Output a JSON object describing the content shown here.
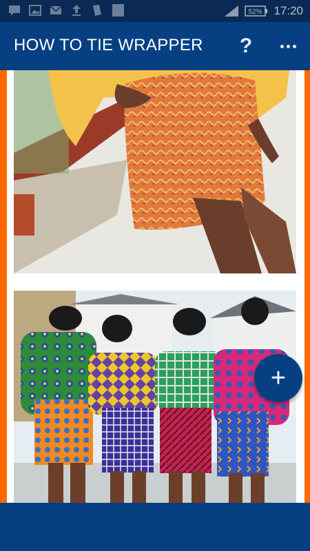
{
  "status_bar": {
    "battery": "52%",
    "time": "17:20",
    "icons": [
      "message-icon",
      "image-icon",
      "mail-icon",
      "upload-icon",
      "file-icon",
      "square-icon",
      "signal-icon",
      "battery-icon"
    ]
  },
  "app_bar": {
    "title": "HOW TO TIE WRAPPER",
    "help_label": "?",
    "menu_icon": "overflow-menu-icon"
  },
  "gallery": {
    "items": [
      {
        "alt": "wrapper-skirt-photo"
      },
      {
        "alt": "group-ankara-outfits-photo"
      }
    ]
  },
  "fab": {
    "label": "+"
  },
  "colors": {
    "primary": "#063f82",
    "status_bar": "#0a2a55",
    "accent": "#ff6a00",
    "fab": "#063f82"
  }
}
